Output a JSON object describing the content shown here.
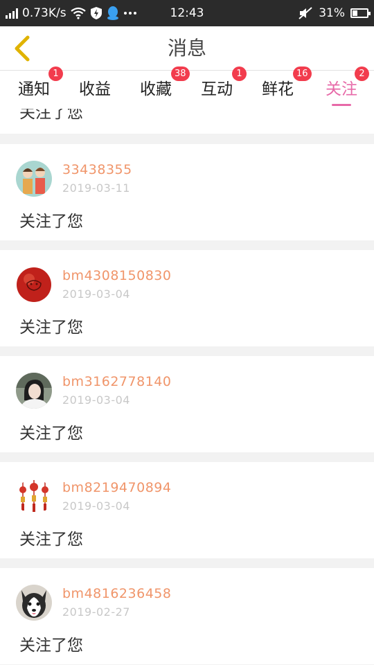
{
  "status_bar": {
    "speed": "0.73K/s",
    "time": "12:43",
    "battery": "31%",
    "battery_level": 0.31
  },
  "header": {
    "title": "消息",
    "back_icon": "chevron-left-icon"
  },
  "tabs": [
    {
      "label": "通知",
      "badge": "1",
      "active": false
    },
    {
      "label": "收益",
      "badge": "",
      "active": false
    },
    {
      "label": "收藏",
      "badge": "38",
      "active": false
    },
    {
      "label": "互动",
      "badge": "1",
      "active": false
    },
    {
      "label": "鲜花",
      "badge": "16",
      "active": false
    },
    {
      "label": "关注",
      "badge": "2",
      "active": true
    }
  ],
  "colors": {
    "accent": "#e769a8",
    "badge": "#f23c4d",
    "username": "#f0956a"
  },
  "partial_item_text": "关注了您",
  "notifications": [
    {
      "username": "33438355",
      "date": "2019-03-11",
      "text": "关注了您",
      "avatar": "couple-illustration"
    },
    {
      "username": "bm4308150830",
      "date": "2019-03-04",
      "text": "关注了您",
      "avatar": "red-ball"
    },
    {
      "username": "bm3162778140",
      "date": "2019-03-04",
      "text": "关注了您",
      "avatar": "girl-photo"
    },
    {
      "username": "bm8219470894",
      "date": "2019-03-04",
      "text": "关注了您",
      "avatar": "red-lanterns"
    },
    {
      "username": "bm4816236458",
      "date": "2019-02-27",
      "text": "关注了您",
      "avatar": "husky-dog"
    }
  ]
}
